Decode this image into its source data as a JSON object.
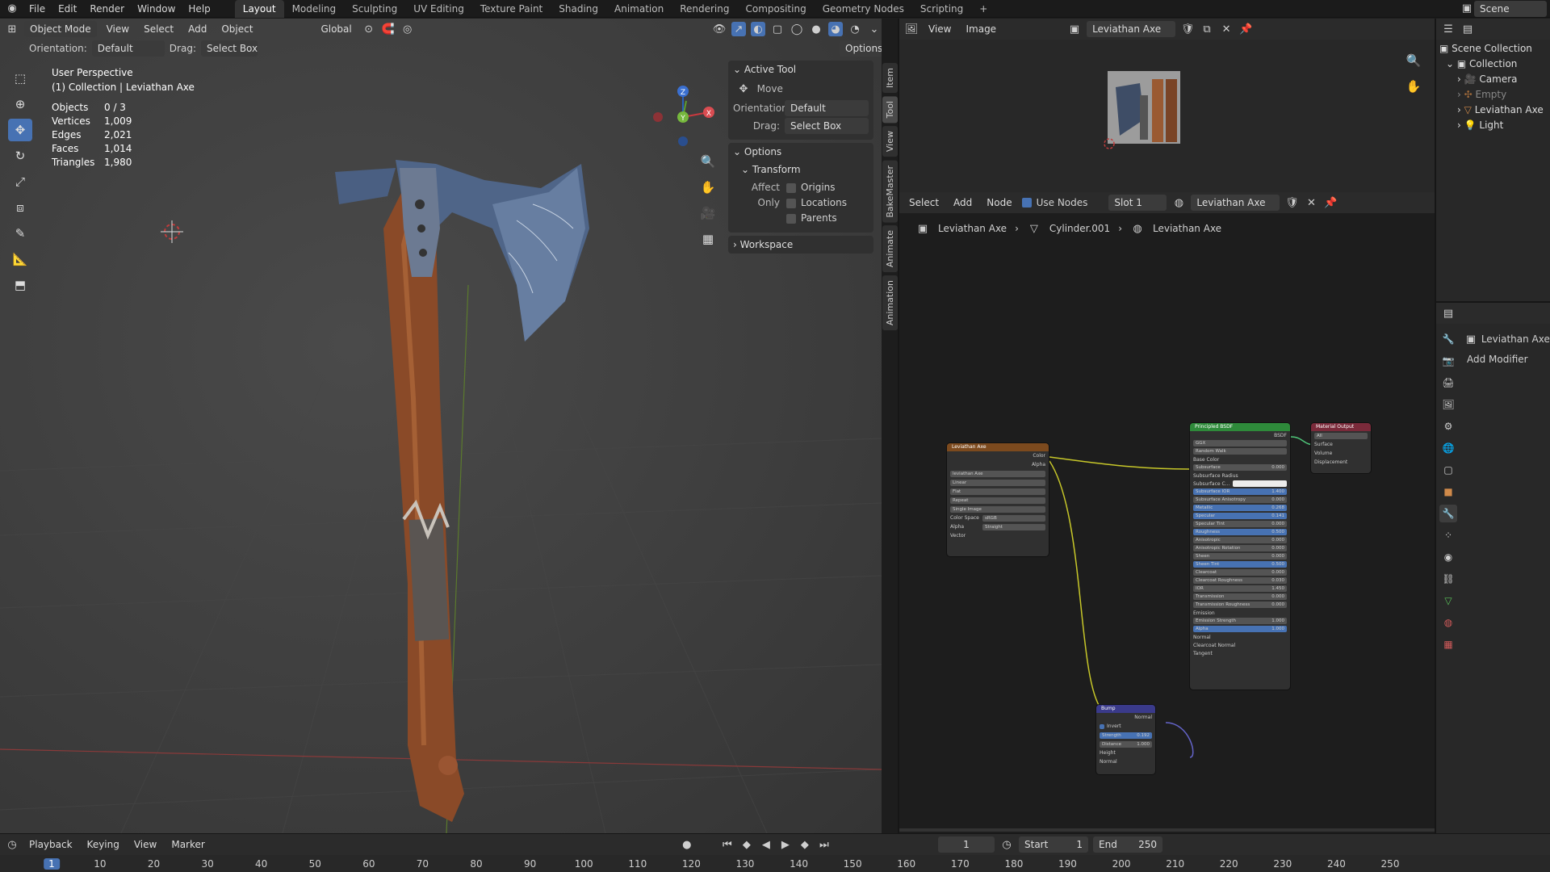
{
  "menu": [
    "File",
    "Edit",
    "Render",
    "Window",
    "Help"
  ],
  "workspaces": [
    "Layout",
    "Modeling",
    "Sculpting",
    "UV Editing",
    "Texture Paint",
    "Shading",
    "Animation",
    "Rendering",
    "Compositing",
    "Geometry Nodes",
    "Scripting"
  ],
  "workspace_add": "+",
  "scene": "Scene",
  "viewport": {
    "mode": "Object Mode",
    "menus": [
      "View",
      "Select",
      "Add",
      "Object"
    ],
    "transform": "Global",
    "options": "Options",
    "orientation_label": "Orientation:",
    "orientation_value": "Default",
    "drag_label": "Drag:",
    "drag_value": "Select Box",
    "title": "User Perspective",
    "collection": "(1) Collection | Leviathan Axe",
    "stats": [
      {
        "k": "Objects",
        "v": "0 / 3"
      },
      {
        "k": "Vertices",
        "v": "1,009"
      },
      {
        "k": "Edges",
        "v": "2,021"
      },
      {
        "k": "Faces",
        "v": "1,014"
      },
      {
        "k": "Triangles",
        "v": "1,980"
      }
    ],
    "gizmo": {
      "z": "Z",
      "y": "Y",
      "x": "X"
    }
  },
  "npanel": {
    "active_tool": "Active Tool",
    "tool_name": "Move",
    "orientation_label": "Orientation",
    "orientation_value": "Default",
    "drag_label": "Drag:",
    "drag_value": "Select Box",
    "options": "Options",
    "transform": "Transform",
    "affect_only": "Affect Only",
    "affect_items": [
      "Origins",
      "Locations",
      "Parents"
    ],
    "workspace": "Workspace",
    "tabs": [
      "Item",
      "Tool",
      "View",
      "BakeMaster",
      "Animate",
      "Animation"
    ]
  },
  "image_editor": {
    "menus": [
      "View",
      "Image"
    ],
    "image_name": "Leviathan Axe"
  },
  "node_editor": {
    "menus": [
      "Select",
      "Add",
      "Node"
    ],
    "use_nodes": "Use Nodes",
    "slot": "Slot 1",
    "material": "Leviathan Axe",
    "breadcrumb": [
      "Leviathan Axe",
      "Cylinder.001",
      "Leviathan Axe"
    ],
    "image_node": {
      "title": "Leviathan Axe",
      "outputs": [
        "Color",
        "Alpha"
      ],
      "image": "leviathan Axe",
      "rows": [
        "Linear",
        "Flat",
        "Repeat",
        "Single Image"
      ],
      "colorspace_label": "Color Space",
      "colorspace": "sRGB",
      "alpha_label": "Alpha",
      "alpha": "Straight",
      "vector": "Vector"
    },
    "bsdf": {
      "title": "Principled BSDF",
      "out": "BSDF",
      "dist": "GGX",
      "sss": "Random Walk",
      "fields": [
        [
          "Base Color",
          ""
        ],
        [
          "Subsurface",
          "0.000"
        ],
        [
          "Subsurface Radius",
          ""
        ],
        [
          "Subsurface C...",
          ""
        ],
        [
          "Subsurface IOR",
          "1.400"
        ],
        [
          "Subsurface Anisotropy",
          "0.000"
        ],
        [
          "Metallic",
          "0.268"
        ],
        [
          "Specular",
          "0.141"
        ],
        [
          "Specular Tint",
          "0.000"
        ],
        [
          "Roughness",
          "0.500"
        ],
        [
          "Anisotropic",
          "0.000"
        ],
        [
          "Anisotropic Rotation",
          "0.000"
        ],
        [
          "Sheen",
          "0.000"
        ],
        [
          "Sheen Tint",
          "0.500"
        ],
        [
          "Clearcoat",
          "0.000"
        ],
        [
          "Clearcoat Roughness",
          "0.030"
        ],
        [
          "IOR",
          "1.450"
        ],
        [
          "Transmission",
          "0.000"
        ],
        [
          "Transmission Roughness",
          "0.000"
        ],
        [
          "Emission",
          ""
        ],
        [
          "Emission Strength",
          "1.000"
        ],
        [
          "Alpha",
          "1.000"
        ],
        [
          "Normal",
          ""
        ],
        [
          "Clearcoat Normal",
          ""
        ],
        [
          "Tangent",
          ""
        ]
      ]
    },
    "bump": {
      "title": "Bump",
      "out": "Normal",
      "invert": "Invert",
      "strength_label": "Strength",
      "strength": "0.192",
      "distance_label": "Distance",
      "distance": "1.000",
      "inputs": [
        "Height",
        "Normal"
      ]
    },
    "output": {
      "title": "Material Output",
      "target": "All",
      "inputs": [
        "Surface",
        "Volume",
        "Displacement"
      ]
    }
  },
  "outliner": {
    "scene_collection": "Scene Collection",
    "items": [
      "Collection",
      "Camera",
      "Empty",
      "Leviathan Axe",
      "Light"
    ]
  },
  "properties": {
    "object": "Leviathan Axe",
    "add_modifier": "Add Modifier"
  },
  "timeline": {
    "menus": [
      "Playback",
      "Keying",
      "View",
      "Marker"
    ],
    "frame": "1",
    "start_label": "Start",
    "start": "1",
    "end_label": "End",
    "end": "250",
    "ticks": [
      "1",
      "10",
      "20",
      "30",
      "40",
      "50",
      "60",
      "70",
      "80",
      "90",
      "100",
      "110",
      "120",
      "130",
      "140",
      "150",
      "160",
      "170",
      "180",
      "190",
      "200",
      "210",
      "220",
      "230",
      "240",
      "250"
    ]
  }
}
